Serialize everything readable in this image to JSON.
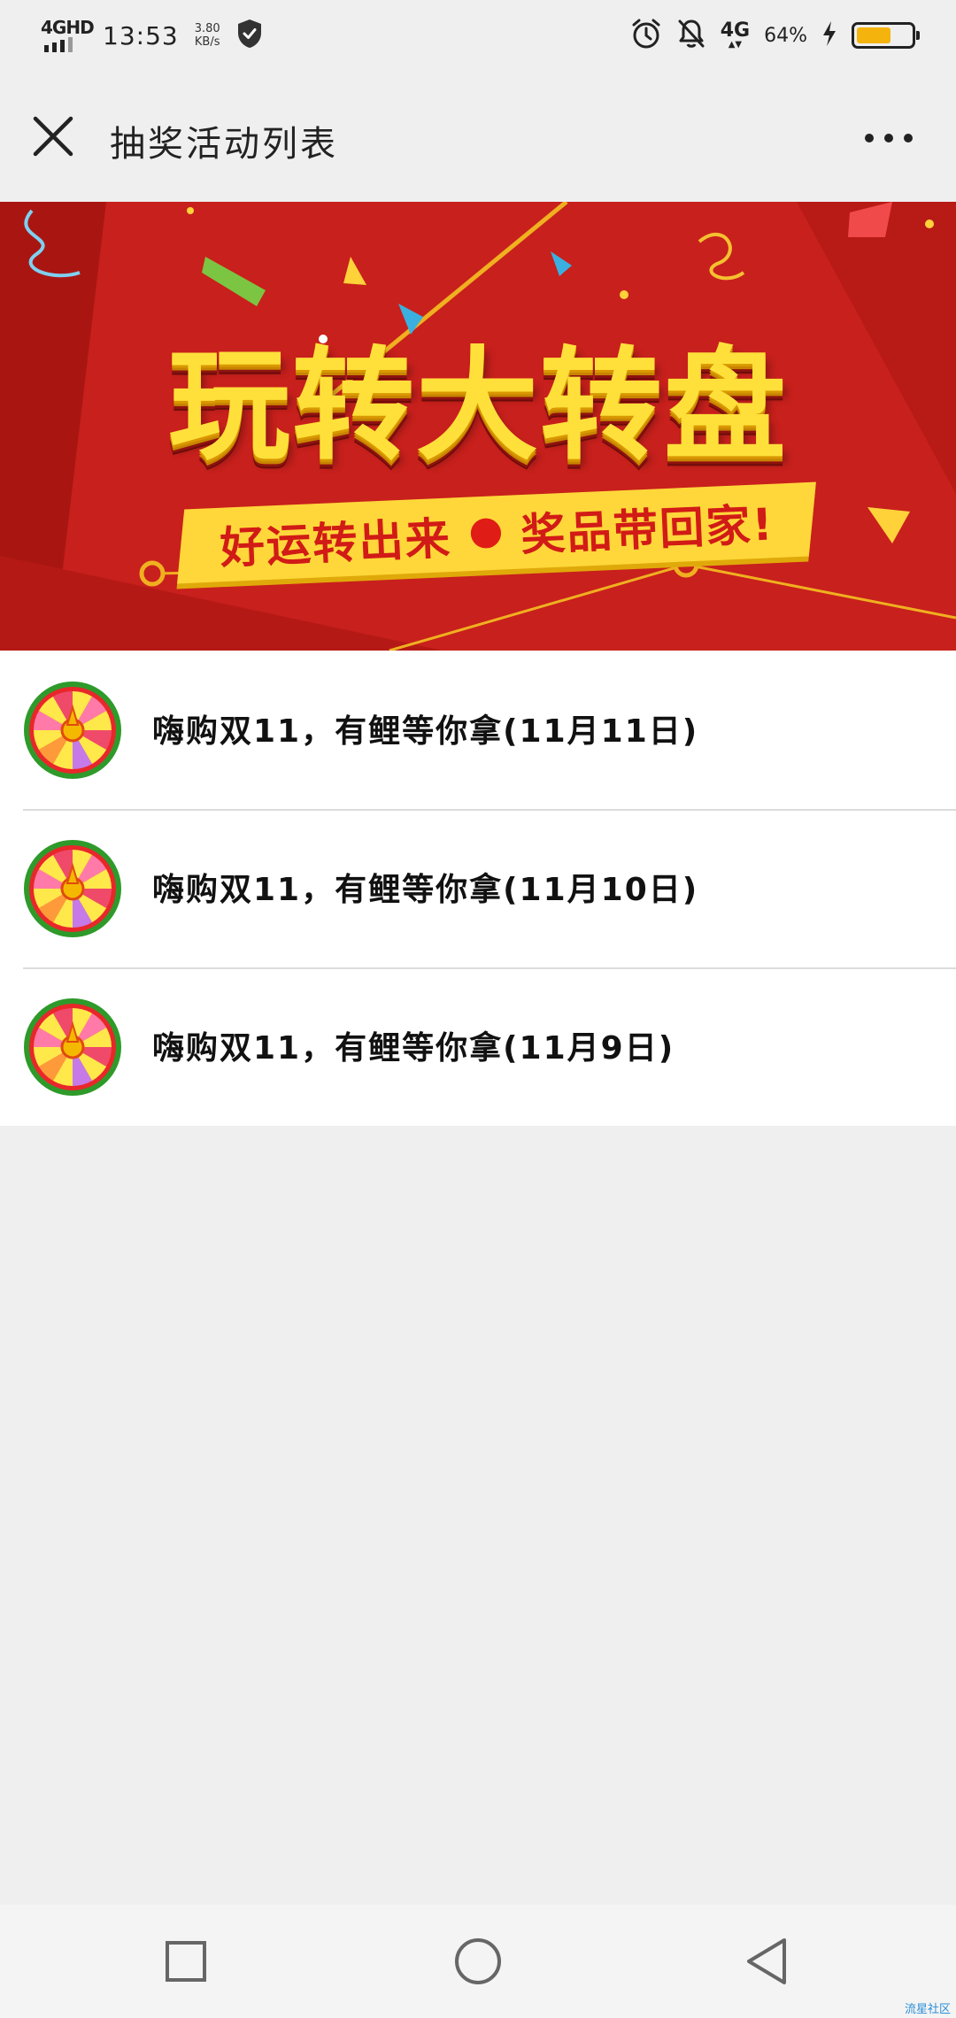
{
  "status_bar": {
    "network_label": "4GHD",
    "time": "13:53",
    "speed_value": "3.80",
    "speed_unit": "KB/s",
    "right_network": "4G",
    "battery_percent_text": "64%",
    "battery_level": 0.64,
    "battery_color": "#f5b30e"
  },
  "header": {
    "title": "抽奖活动列表",
    "close_icon": "close-icon",
    "more_icon": "more-dots-icon"
  },
  "banner": {
    "title": "玩转大转盘",
    "subtitle_left": "好运转出来",
    "subtitle_right": "奖品带回家!",
    "bg_color": "#c8201c",
    "title_color": "#ffe03a"
  },
  "activities": [
    {
      "label": "嗨购双11，有鲤等你拿(11月11日)",
      "icon": "prize-wheel-icon"
    },
    {
      "label": "嗨购双11，有鲤等你拿(11月10日)",
      "icon": "prize-wheel-icon"
    },
    {
      "label": "嗨购双11，有鲤等你拿(11月9日)",
      "icon": "prize-wheel-icon"
    }
  ],
  "nav_bar": {
    "buttons": [
      "recent-apps-icon",
      "home-icon",
      "back-icon"
    ],
    "watermark": "流星社区"
  }
}
